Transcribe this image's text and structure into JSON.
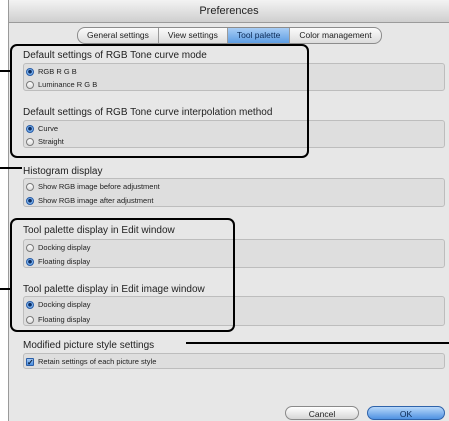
{
  "window": {
    "title": "Preferences"
  },
  "tabs": [
    {
      "label": "General settings",
      "active": false
    },
    {
      "label": "View settings",
      "active": false
    },
    {
      "label": "Tool palette",
      "active": true
    },
    {
      "label": "Color management",
      "active": false
    }
  ],
  "sections": {
    "rgb_tone_curve_mode": {
      "title": "Default settings of RGB Tone curve mode",
      "options": [
        {
          "label": "RGB R G B",
          "selected": true
        },
        {
          "label": "Luminance R G B",
          "selected": false
        }
      ]
    },
    "interpolation_method": {
      "title": "Default settings of RGB Tone curve interpolation method",
      "options": [
        {
          "label": "Curve",
          "selected": true
        },
        {
          "label": "Straight",
          "selected": false
        }
      ]
    },
    "histogram_display": {
      "title": "Histogram display",
      "options": [
        {
          "label": "Show RGB image before adjustment",
          "selected": false
        },
        {
          "label": "Show RGB image after adjustment",
          "selected": true
        }
      ]
    },
    "edit_window_display": {
      "title": "Tool palette display in Edit window",
      "options": [
        {
          "label": "Docking display",
          "selected": false
        },
        {
          "label": "Floating display",
          "selected": true
        }
      ]
    },
    "edit_image_window_display": {
      "title": "Tool palette display in Edit image window",
      "options": [
        {
          "label": "Docking display",
          "selected": true
        },
        {
          "label": "Floating display",
          "selected": false
        }
      ]
    },
    "modified_picture_style": {
      "title": "Modified picture style settings",
      "checkbox": {
        "label": "Retain settings of each picture style",
        "checked": true
      }
    }
  },
  "buttons": {
    "cancel": "Cancel",
    "ok": "OK"
  },
  "colors": {
    "selected_accent": "#4a8ee0",
    "window_bg": "#e7e7e7",
    "callout": "#000000"
  }
}
